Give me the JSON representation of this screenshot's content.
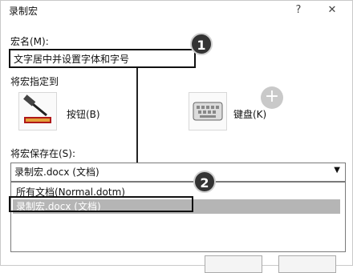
{
  "window": {
    "title": "录制宏",
    "help_glyph": "?",
    "close_glyph": "✕"
  },
  "macro_name": {
    "label": "宏名(M):",
    "value": "文字居中并设置字体和字号"
  },
  "assign_to": {
    "label": "将宏指定到",
    "button_label": "按钮(B)",
    "keyboard_label": "键盘(K)"
  },
  "store_in": {
    "label": "将宏保存在(S):",
    "selected": "录制宏.docx (文档)",
    "options": [
      "所有文档(Normal.dotm)",
      "录制宏.docx (文档)"
    ]
  },
  "callouts": [
    "1",
    "2"
  ],
  "icons": [
    "hammer-icon",
    "keyboard-icon",
    "plus-icon",
    "chevron-down-icon"
  ],
  "colors": {
    "selection": "#b5b5b5",
    "callout": "#333333"
  }
}
